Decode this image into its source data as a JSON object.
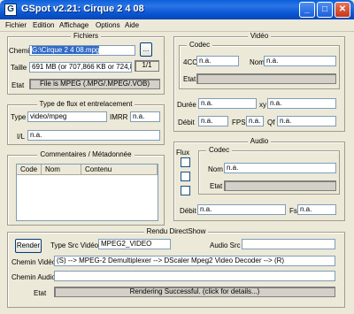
{
  "window": {
    "title": "GSpot v2.21: Cirque 2 4 08",
    "icon": "gspot-app-icon",
    "buttons": {
      "minimize": "_",
      "maximize": "□",
      "close": "✕"
    }
  },
  "menu": [
    "Fichier",
    "Edition",
    "Affichage",
    "Options",
    "Aide"
  ],
  "fichiers": {
    "legend": "Fichiers",
    "chemin_label": "Chemin",
    "chemin_value": "G:\\Cirque 2 4 08.mpg",
    "browse_label": "...",
    "taille_label": "Taille",
    "taille_value": "691 MB (or 707,866 KB or 724,85",
    "page_label": "1/1",
    "etat_label": "Etat",
    "etat_value": "File is MPEG (.MPG/.MPEG/.VOB)"
  },
  "type_flux": {
    "legend": "Type de flux et entrelacement",
    "type_label": "Type",
    "type_value": "video/mpeg",
    "imrr_label": "IMRR",
    "imrr_value": "n.a.",
    "il_label": "I/L",
    "il_value": "n.a."
  },
  "commentaires": {
    "legend": "Commentaires / Métadonnée",
    "columns": [
      "Code",
      "Nom",
      "Contenu"
    ]
  },
  "video": {
    "legend": "Vidéo",
    "codec_legend": "Codec",
    "fourcc_label": "4CC",
    "fourcc_value": "n.a.",
    "nom_label": "Nom",
    "nom_value": "n.a.",
    "etat_label": "Etat",
    "duree_label": "Durée",
    "duree_value": "n.a.",
    "xy_label": "xy",
    "xy_value": "n.a.",
    "debit_label": "Débit",
    "debit_value": "n.a.",
    "fps_label": "FPS",
    "fps_value": "n.a.",
    "qf_label": "Qf",
    "qf_value": "n.a."
  },
  "audio": {
    "legend": "Audio",
    "flux_label": "Flux",
    "codec_legend": "Codec",
    "nom_label": "Nom",
    "nom_value": "n.a.",
    "etat_label": "Etat",
    "debit_label": "Débit",
    "debit_value": "n.a.",
    "fs_label": "Fs",
    "fs_value": "n.a."
  },
  "rendu": {
    "legend": "Rendu DirectShow",
    "render_button": "Render",
    "type_src_label": "Type Src Vidéo",
    "type_src_value": "MPEG2_VIDEO",
    "audio_src_label": "Audio Src",
    "chemin_video_label": "Chemin Vidéo",
    "chemin_video_value": "(S) --> MPEG-2 Demultiplexer --> DScaler Mpeg2 Video Decoder --> (R)",
    "chemin_audio_label": "Chemin Audio",
    "etat_label": "Etat",
    "etat_value": "Rendering Successful.  (click for details...)"
  }
}
